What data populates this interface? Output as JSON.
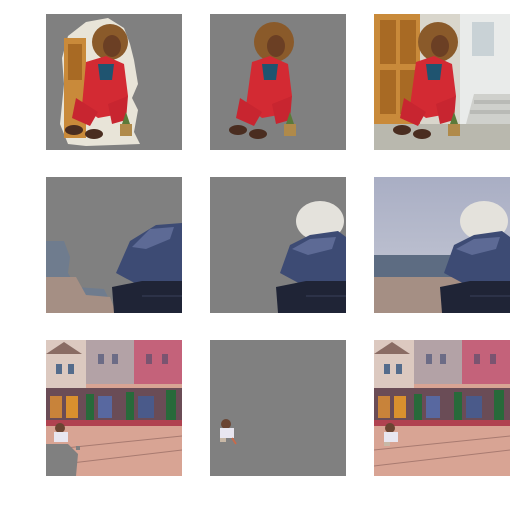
{
  "figure": {
    "rows": [
      {
        "subject": "woman-in-red-suit",
        "panels": [
          "masked-background",
          "masked-foreground",
          "original"
        ]
      },
      {
        "subject": "person-in-fur-hood",
        "panels": [
          "masked-background",
          "masked-foreground",
          "original"
        ]
      },
      {
        "subject": "street-tram-scene",
        "panels": [
          "masked-background",
          "masked-foreground",
          "original"
        ]
      }
    ],
    "colors": {
      "mask_gray": "#808080",
      "page_background": "#ffffff"
    }
  }
}
